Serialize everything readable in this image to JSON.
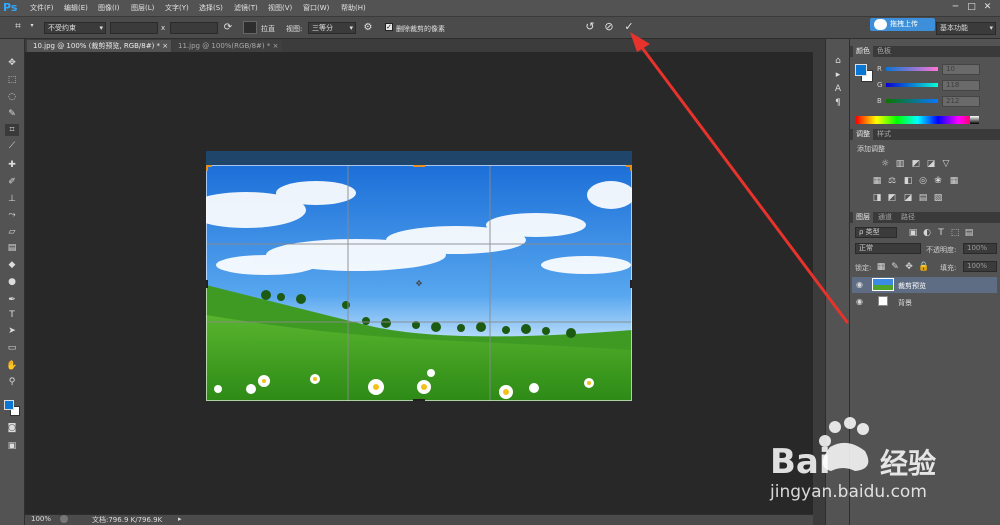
{
  "app": {
    "logo": "Ps"
  },
  "menu": [
    "文件(F)",
    "编辑(E)",
    "图像(I)",
    "图层(L)",
    "文字(Y)",
    "选择(S)",
    "滤镜(T)",
    "视图(V)",
    "窗口(W)",
    "帮助(H)"
  ],
  "window_controls": [
    "─",
    "□",
    "✕"
  ],
  "options": {
    "ratio": "不受约束",
    "x_sep": "x",
    "straighten": "拉直",
    "view_label": "视图:",
    "view_value": "三等分",
    "delete_cropped_label": "删除裁剪的像素",
    "delete_cropped_checked": true,
    "upload_label": "拖拽上传",
    "workspace": "基本功能"
  },
  "tabs": [
    {
      "label": "10.jpg @ 100% (裁剪预览, RGB/8#) *",
      "active": true,
      "close": "×"
    },
    {
      "label": "11.jpg @ 100%(RGB/8#) *",
      "active": false,
      "close": "×"
    }
  ],
  "status": {
    "zoom": "100%",
    "doc": "文档:796.9 K/796.9K"
  },
  "color_panel": {
    "tabs": [
      "颜色",
      "色板"
    ],
    "channels": [
      {
        "label": "R",
        "value": "10"
      },
      {
        "label": "G",
        "value": "118"
      },
      {
        "label": "B",
        "value": "212"
      }
    ],
    "fg_color": "#0a76d4",
    "bg_color": "#ffffff"
  },
  "adjust_panel": {
    "tabs": [
      "调整",
      "样式"
    ],
    "title": "添加调整"
  },
  "layers_panel": {
    "tabs": [
      "图层",
      "通道",
      "路径"
    ],
    "filter": "ρ 类型",
    "blend_mode": "正常",
    "opacity_label": "不透明度:",
    "opacity": "100%",
    "lock_label": "锁定:",
    "fill_label": "填充:",
    "fill": "100%",
    "layers": [
      {
        "name": "裁剪预览",
        "selected": true
      },
      {
        "name": "背景",
        "selected": false
      }
    ]
  },
  "watermark": {
    "brand": "Bai 经验",
    "url": "jingyan.baidu.com"
  },
  "colors": {
    "annotation_arrow": "#e8322c",
    "accent": "#3c8fd8"
  }
}
